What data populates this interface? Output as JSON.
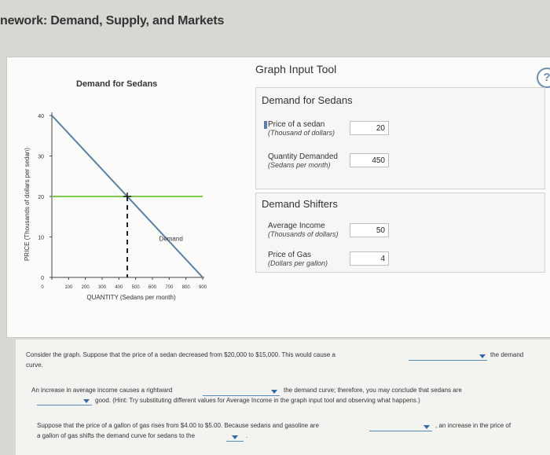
{
  "header": {
    "title": "nework: Demand, Supply, and Markets"
  },
  "help": {
    "icon": "help-icon",
    "glyph": "?"
  },
  "graph_tool": {
    "title": "Graph Input Tool",
    "demand_box": {
      "title": "Demand for Sedans",
      "price_label": "Price of a sedan",
      "price_unit": "(Thousand of dollars)",
      "price_value": "20",
      "qty_label": "Quantity Demanded",
      "qty_unit": "(Sedans per month)",
      "qty_value": "450"
    },
    "shifters_box": {
      "title": "Demand Shifters",
      "income_label": "Average Income",
      "income_unit": "(Thousands of dollars)",
      "income_value": "50",
      "gas_label": "Price of Gas",
      "gas_unit": "(Dollars per gallon)",
      "gas_value": "4"
    }
  },
  "chart_data": {
    "type": "line",
    "title": "Demand for Sedans",
    "xlabel": "QUANTITY (Sedans per month)",
    "ylabel": "PRICE (Thousands of dollars per sedan)",
    "xlim": [
      0,
      900
    ],
    "ylim": [
      0,
      40
    ],
    "x_ticks": [
      0,
      100,
      200,
      300,
      400,
      500,
      600,
      700,
      800,
      900
    ],
    "y_ticks": [
      0,
      10,
      20,
      30,
      40
    ],
    "series": [
      {
        "name": "Demand",
        "color": "#5b7fa6",
        "points": [
          [
            0,
            40
          ],
          [
            900,
            0
          ]
        ]
      }
    ],
    "price_line": {
      "y": 20,
      "color": "#7ec850"
    },
    "selected_point": {
      "x": 450,
      "y": 20
    },
    "grid": false
  },
  "questions": {
    "q1_a": "Consider the graph. Suppose that the price of a sedan decreased from $20,000 to $15,000. This would cause a",
    "q1_b": "the demand",
    "q1_c": "curve.",
    "q2_a": "An increase in average income causes a rightward",
    "q2_b": "the demand curve; therefore, you may conclude that sedans are",
    "q2_c": "good. (Hint: Try substituting different values for Average Income in the graph input tool and observing what happens.)",
    "q3_a": "Suppose that the price of a gallon of gas rises from $4.00 to $5.00. Because sedans and gasoline are",
    "q3_b": ", an increase in the price of",
    "q3_c": "a gallon of gas shifts the demand curve for sedans to the"
  }
}
